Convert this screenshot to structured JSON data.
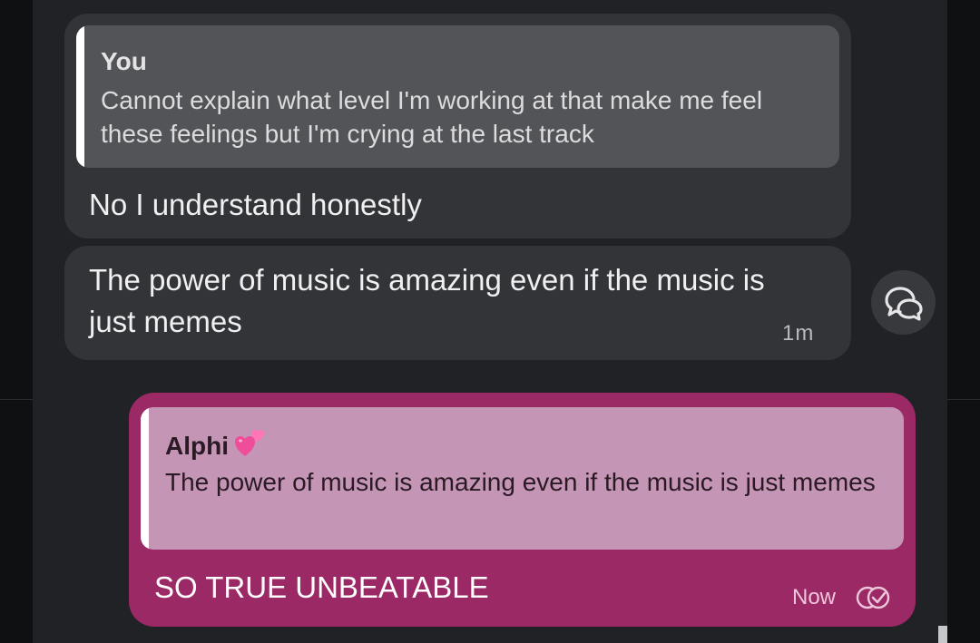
{
  "messages": {
    "incoming_1": {
      "quote_author": "You",
      "quote_text": "Cannot explain what level I'm working at that make me feel these feelings but I'm crying at the last track",
      "text": "No I understand honestly"
    },
    "incoming_2": {
      "text": "The power of music is amazing even if the music is just memes",
      "time": "1m"
    },
    "outgoing": {
      "quote_author": "Alphi",
      "quote_text": "The power of music is amazing even if the music is just memes",
      "text": "SO TRUE UNBEATABLE",
      "time": "Now"
    }
  },
  "icons": {
    "reaction": "chat-bubbles-icon",
    "read_status": "double-check-icon",
    "emoji": "two-hearts-icon"
  },
  "colors": {
    "background": "#212225",
    "incoming_bubble": "#333437",
    "incoming_quote": "#535457",
    "outgoing_bubble": "#9b2966",
    "outgoing_quote": "#c595b6"
  }
}
